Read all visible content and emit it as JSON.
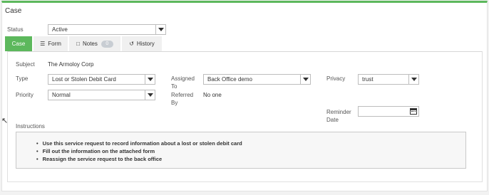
{
  "panel": {
    "title": "Case"
  },
  "status": {
    "label": "Status",
    "value": "Active"
  },
  "tabs": [
    {
      "label": "Case",
      "icon": ""
    },
    {
      "label": "Form",
      "icon": "list-icon"
    },
    {
      "label": "Notes",
      "icon": "note-icon",
      "badge": "0"
    },
    {
      "label": "History",
      "icon": "history-icon"
    }
  ],
  "case": {
    "subject_label": "Subject",
    "subject_value": "The Armoloy Corp",
    "type_label": "Type",
    "type_value": "Lost or Stolen Debit Card",
    "priority_label": "Priority",
    "priority_value": "Normal",
    "assigned_label_1": "Assigned",
    "assigned_label_2": "To",
    "assigned_value": "Back Office demo",
    "referred_label_1": "Referred",
    "referred_label_2": "By",
    "referred_value": "No one",
    "privacy_label": "Privacy",
    "privacy_value": "trust",
    "reminder_label_1": "Reminder",
    "reminder_label_2": "Date",
    "reminder_value": ""
  },
  "instructions": {
    "label": "Instructions",
    "items": [
      "Use this service request to record information about a lost or stolen debit card",
      "Fill out the information on the attached form",
      "Reassign the service request to the back office"
    ]
  },
  "colors": {
    "accent": "#5cb85c",
    "badge": "#c8cdd3"
  }
}
